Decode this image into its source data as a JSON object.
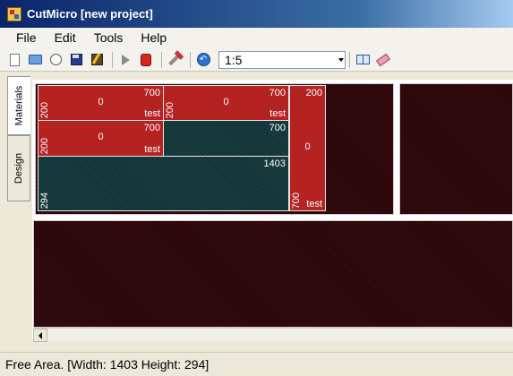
{
  "window": {
    "title": "CutMicro [new project]"
  },
  "menu": {
    "items": [
      "File",
      "Edit",
      "Tools",
      "Help"
    ]
  },
  "toolbar": {
    "scale_value": "1:5",
    "icons": [
      "new-file-icon",
      "open-folder-icon",
      "recent-icon",
      "save-icon",
      "save-as-icon",
      "run-icon",
      "stop-icon",
      "tools-icon",
      "back-icon",
      "layout-icon",
      "eraser-icon"
    ]
  },
  "tabs": [
    {
      "label": "Materials"
    },
    {
      "label": "Design"
    }
  ],
  "pieces": [
    {
      "width": "700",
      "height": "200",
      "count": "0",
      "name": "test",
      "color": "red"
    },
    {
      "width": "700",
      "height": "200",
      "count": "0",
      "name": "test",
      "color": "red"
    },
    {
      "width": "200",
      "height": "700",
      "count": "0",
      "name": "test",
      "color": "red"
    },
    {
      "width": "700",
      "height": "200",
      "count": "0",
      "name": "test",
      "color": "red"
    },
    {
      "width": "700",
      "color": "teal"
    },
    {
      "width": "1403",
      "height": "294",
      "color": "teal"
    }
  ],
  "colors": {
    "piece": "#b52222",
    "free_area": "#123236",
    "sheet": "#2b0408"
  },
  "status": {
    "text": "Free Area. [Width: 1403 Height: 294]"
  }
}
